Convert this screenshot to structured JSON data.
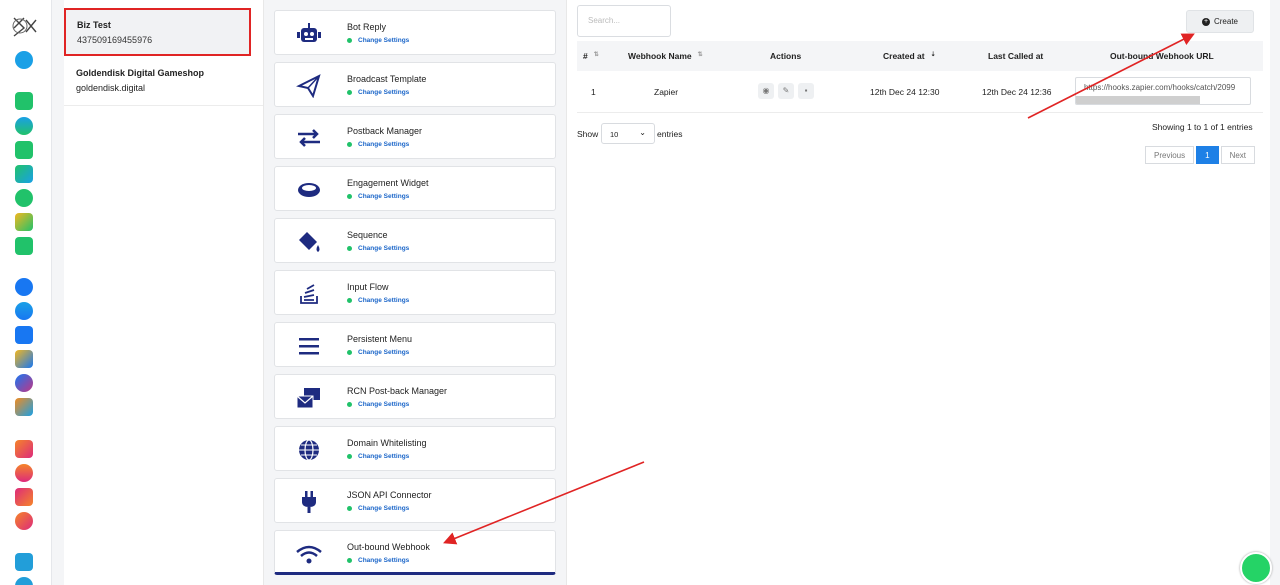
{
  "accounts": [
    {
      "name": "Biz Test",
      "id": "437509169455976",
      "selected": true
    },
    {
      "name": "Goldendisk Digital Gameshop",
      "id": "goldendisk.digital",
      "selected": false
    }
  ],
  "features": [
    {
      "title": "Bot Reply",
      "link": "Change Settings",
      "icon": "robot-icon"
    },
    {
      "title": "Broadcast Template",
      "link": "Change Settings",
      "icon": "paper-plane-icon"
    },
    {
      "title": "Postback Manager",
      "link": "Change Settings",
      "icon": "exchange-arrows-icon"
    },
    {
      "title": "Engagement Widget",
      "link": "Change Settings",
      "icon": "ring-icon"
    },
    {
      "title": "Sequence",
      "link": "Change Settings",
      "icon": "paint-bucket-icon"
    },
    {
      "title": "Input Flow",
      "link": "Change Settings",
      "icon": "stack-icon"
    },
    {
      "title": "Persistent Menu",
      "link": "Change Settings",
      "icon": "hamburger-menu-icon"
    },
    {
      "title": "RCN Post-back Manager",
      "link": "Change Settings",
      "icon": "envelope-icon"
    },
    {
      "title": "Domain Whitelisting",
      "link": "Change Settings",
      "icon": "globe-icon"
    },
    {
      "title": "JSON API Connector",
      "link": "Change Settings",
      "icon": "plug-icon"
    },
    {
      "title": "Out-bound Webhook",
      "link": "Change Settings",
      "icon": "wifi-icon"
    }
  ],
  "webhooks": {
    "search_placeholder": "Search...",
    "create_label": "Create",
    "columns": [
      "#",
      "Webhook Name",
      "Actions",
      "Created at",
      "Last Called at",
      "Out-bound Webhook URL"
    ],
    "rows": [
      {
        "num": "1",
        "name": "Zapier",
        "created": "12th Dec 24 12:30",
        "last_called": "12th Dec 24 12:36",
        "url": "https://hooks.zapier.com/hooks/catch/2099"
      }
    ],
    "show_label": "Show",
    "page_size": "10",
    "entries_label": "entries",
    "showing_text": "Showing 1 to 1 of 1 entries",
    "prev_label": "Previous",
    "current_page": "1",
    "next_label": "Next"
  },
  "colors": {
    "accent": "#1e2b80",
    "link": "#1b66c9",
    "status_dot": "#21c26a",
    "highlight": "#e02424"
  }
}
